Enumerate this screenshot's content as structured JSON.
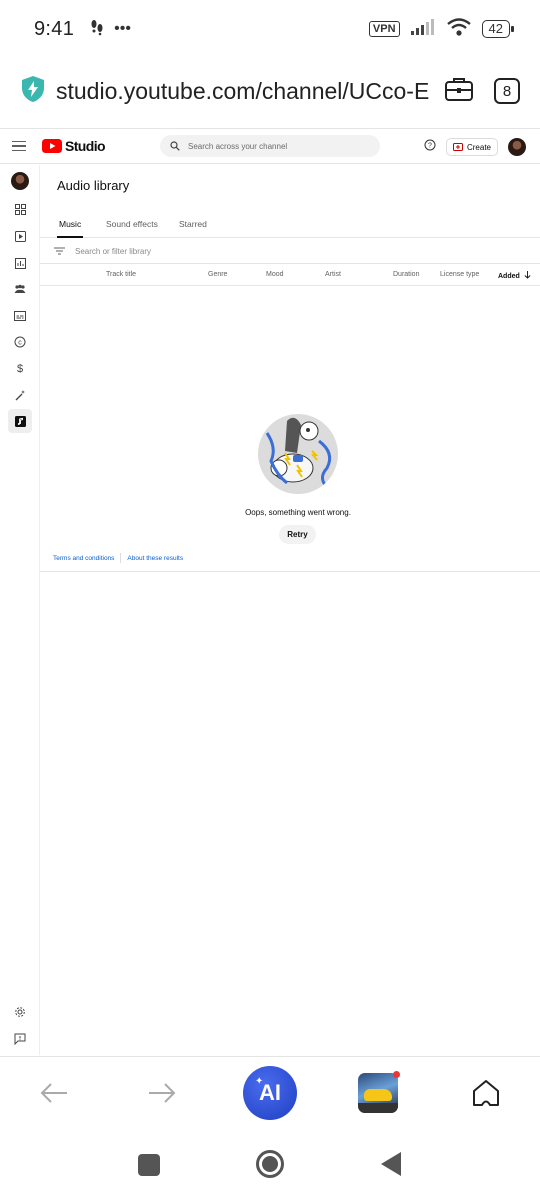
{
  "status_bar": {
    "time": "9:41",
    "dots": "•••",
    "vpn": "VPN",
    "battery": "42"
  },
  "browser": {
    "url": "studio.youtube.com/channel/UCco-E",
    "tab_count": "8"
  },
  "studio": {
    "logo_text": "Studio",
    "search_placeholder": "Search across your channel",
    "create_label": "Create"
  },
  "sidebar": {
    "items": [
      {
        "icon": "avatar"
      },
      {
        "icon": "dashboard-icon"
      },
      {
        "icon": "content-icon"
      },
      {
        "icon": "analytics-icon"
      },
      {
        "icon": "community-icon"
      },
      {
        "icon": "subtitles-icon"
      },
      {
        "icon": "copyright-icon"
      },
      {
        "icon": "earn-icon"
      },
      {
        "icon": "customization-icon"
      },
      {
        "icon": "audio-library-icon"
      },
      {
        "icon": "settings-icon"
      },
      {
        "icon": "feedback-icon"
      }
    ]
  },
  "main": {
    "title": "Audio library",
    "tabs": [
      {
        "label": "Music",
        "active": true
      },
      {
        "label": "Sound effects",
        "active": false
      },
      {
        "label": "Starred",
        "active": false
      }
    ],
    "filter_placeholder": "Search or filter library",
    "columns": [
      "Track title",
      "Genre",
      "Mood",
      "Artist",
      "Duration",
      "License type",
      "Added"
    ],
    "sort_column": "Added",
    "error_message": "Oops, something went wrong.",
    "retry_label": "Retry",
    "footer_links": [
      "Terms and conditions",
      "About these results"
    ]
  },
  "bottom_bar": {
    "ai_label": "AI"
  },
  "colors": {
    "youtube_red": "#ff0000",
    "link_blue": "#065fd4",
    "ai_blue": "#2f4fd8"
  }
}
